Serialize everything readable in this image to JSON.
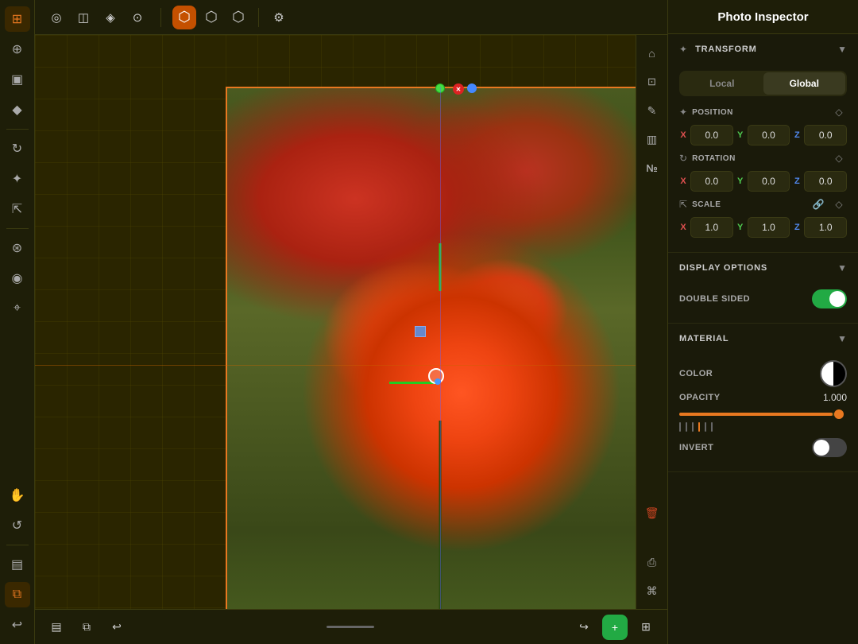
{
  "app": {
    "title": "Photo Inspector"
  },
  "left_toolbar": {
    "tools": [
      {
        "name": "grid-icon",
        "symbol": "⊞",
        "active": true
      },
      {
        "name": "cursor-icon",
        "symbol": "⊕",
        "active": false
      },
      {
        "name": "box-icon",
        "symbol": "▣",
        "active": false
      },
      {
        "name": "diamond-icon",
        "symbol": "◆",
        "active": true,
        "accent": true
      },
      {
        "name": "rotate-icon",
        "symbol": "↻",
        "active": false
      },
      {
        "name": "move-icon",
        "symbol": "✦",
        "active": false
      },
      {
        "name": "scale-icon",
        "symbol": "⇱",
        "active": false
      },
      {
        "name": "link-icon",
        "symbol": "⊛",
        "active": false
      },
      {
        "name": "globe-icon",
        "symbol": "◉",
        "active": false
      },
      {
        "name": "node-icon",
        "symbol": "⌖",
        "active": false
      },
      {
        "name": "hand-icon",
        "symbol": "✋",
        "active": false
      },
      {
        "name": "orbit-icon",
        "symbol": "↺",
        "active": false
      },
      {
        "name": "layers-icon",
        "symbol": "▤",
        "active": false
      },
      {
        "name": "clone-icon",
        "symbol": "⧉",
        "active": false
      },
      {
        "name": "undo-icon",
        "symbol": "↩",
        "active": false
      }
    ]
  },
  "top_toolbar": {
    "groups": [
      {
        "tools": [
          {
            "name": "sphere-wire-icon",
            "symbol": "◎",
            "active": false
          },
          {
            "name": "box-wire-icon",
            "symbol": "◫",
            "active": false
          },
          {
            "name": "diamond-wire-icon",
            "symbol": "◈",
            "active": false
          },
          {
            "name": "circle-dot-icon",
            "symbol": "⊙",
            "active": false
          }
        ]
      },
      {
        "tools": [
          {
            "name": "cube-orange-icon",
            "symbol": "⬡",
            "active": true,
            "accent": true
          },
          {
            "name": "cube-wire2-icon",
            "symbol": "⬡",
            "active": false
          },
          {
            "name": "cube-flat-icon",
            "symbol": "⬡",
            "active": false
          },
          {
            "name": "settings-icon",
            "symbol": "⚙",
            "active": false
          }
        ]
      }
    ]
  },
  "viewport": {
    "gizmo": {
      "has_selection": true
    }
  },
  "right_viewport_tools": [
    {
      "name": "home-icon",
      "symbol": "⌂"
    },
    {
      "name": "frame-icon",
      "symbol": "⊡"
    },
    {
      "name": "pencil-icon",
      "symbol": "✎"
    },
    {
      "name": "panels-icon",
      "symbol": "▥"
    },
    {
      "name": "number-icon",
      "symbol": "№"
    },
    {
      "name": "trash-icon",
      "symbol": "🗑"
    },
    {
      "name": "share-icon",
      "symbol": "⎙"
    },
    {
      "name": "command-icon",
      "symbol": "⌘"
    }
  ],
  "bottom_bar": {
    "left_tools": [
      {
        "name": "layers-bottom-icon",
        "symbol": "▤"
      },
      {
        "name": "clone-bottom-icon",
        "symbol": "⧉"
      },
      {
        "name": "undo-bottom-icon",
        "symbol": "↩"
      }
    ],
    "center_tools": [
      {
        "name": "redo-icon",
        "symbol": "↪"
      },
      {
        "name": "add-icon",
        "symbol": "+",
        "accent": true
      },
      {
        "name": "grid-bottom-icon",
        "symbol": "⊞"
      }
    ]
  },
  "right_panel": {
    "title": "Photo Inspector",
    "sections": {
      "transform": {
        "label": "TRANSFORM",
        "toggle": {
          "local": "Local",
          "global": "Global",
          "active": "Global"
        },
        "position": {
          "label": "POSITION",
          "x": "0.0",
          "y": "0.0",
          "z": "0.0"
        },
        "rotation": {
          "label": "ROTATION",
          "x": "0.0",
          "y": "0.0",
          "z": "0.0"
        },
        "scale": {
          "label": "SCALE",
          "x": "1.0",
          "y": "1.0",
          "z": "1.0"
        }
      },
      "display_options": {
        "label": "DISPLAY OPTIONS",
        "double_sided": {
          "label": "DOUBLE SIDED",
          "value": true
        }
      },
      "material": {
        "label": "MATERIAL",
        "color": {
          "label": "COLOR"
        },
        "opacity": {
          "label": "OPACITY",
          "value": "1.000"
        },
        "invert": {
          "label": "INVERT",
          "value": false
        }
      }
    }
  }
}
